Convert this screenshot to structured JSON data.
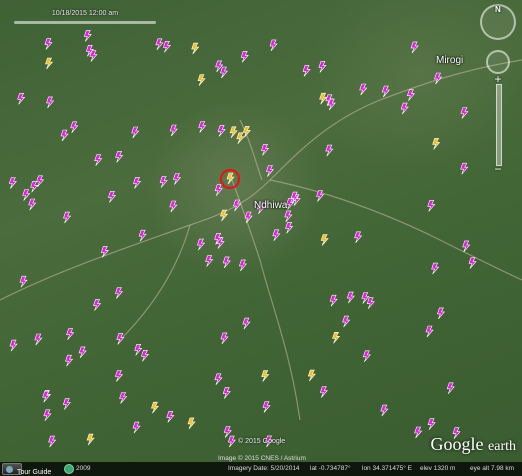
{
  "timeslider": {
    "label": "10/18/2015  12:00 am"
  },
  "places": [
    {
      "name": "Mirogi"
    },
    {
      "name": "Ndhiwa"
    }
  ],
  "copyright": "© 2015 Google",
  "logo": {
    "google": "Google",
    "earth": "earth"
  },
  "status": {
    "tour_guide": "Tour Guide",
    "year": "2009",
    "imagery_date": "Imagery Date: 5/20/2014",
    "lat": "lat    -0.734787°",
    "lon": "lon   34.371475° E",
    "elev": "elev  1320 m",
    "eye_alt": "eye alt   7.98 km"
  },
  "image_credit": "Image © 2015 CNES / Astrium",
  "nav": {
    "north": "N"
  },
  "colors": {
    "magenta_marker": "#e020e0",
    "yellow_marker": "#f0c020",
    "highlight_ring": "#e01818"
  },
  "markers": [
    {
      "c": "m"
    },
    {
      "c": "m"
    },
    {
      "c": "m"
    },
    {
      "c": "m"
    },
    {
      "c": "m"
    },
    {
      "c": "m"
    },
    {
      "c": "m"
    },
    {
      "c": "y"
    },
    {
      "c": "m"
    },
    {
      "c": "m"
    },
    {
      "c": "m"
    },
    {
      "c": "m"
    },
    {
      "c": "m"
    },
    {
      "c": "m"
    },
    {
      "c": "m"
    },
    {
      "c": "m"
    },
    {
      "c": "y"
    },
    {
      "c": "m"
    },
    {
      "c": "m"
    },
    {
      "c": "m"
    },
    {
      "c": "m"
    },
    {
      "c": "m"
    },
    {
      "c": "m"
    },
    {
      "c": "y"
    },
    {
      "c": "m"
    },
    {
      "c": "m"
    },
    {
      "c": "m"
    },
    {
      "c": "m"
    },
    {
      "c": "m"
    },
    {
      "c": "m"
    },
    {
      "c": "m"
    },
    {
      "c": "m"
    },
    {
      "c": "m"
    },
    {
      "c": "y"
    },
    {
      "c": "m"
    },
    {
      "c": "m"
    },
    {
      "c": "m"
    },
    {
      "c": "m"
    },
    {
      "c": "m"
    },
    {
      "c": "m"
    },
    {
      "c": "m"
    },
    {
      "c": "m"
    },
    {
      "c": "m"
    },
    {
      "c": "y"
    },
    {
      "c": "m"
    },
    {
      "c": "m"
    },
    {
      "c": "m"
    },
    {
      "c": "m"
    },
    {
      "c": "m"
    },
    {
      "c": "m"
    },
    {
      "c": "m"
    },
    {
      "c": "y"
    },
    {
      "c": "m"
    },
    {
      "c": "m"
    },
    {
      "c": "m"
    },
    {
      "c": "m"
    },
    {
      "c": "m"
    },
    {
      "c": "m"
    },
    {
      "c": "y"
    },
    {
      "c": "m"
    },
    {
      "c": "m"
    },
    {
      "c": "m"
    },
    {
      "c": "m"
    },
    {
      "c": "m"
    },
    {
      "c": "m"
    },
    {
      "c": "m"
    },
    {
      "c": "m"
    },
    {
      "c": "y"
    },
    {
      "c": "m"
    },
    {
      "c": "m"
    },
    {
      "c": "m"
    },
    {
      "c": "m"
    },
    {
      "c": "m"
    },
    {
      "c": "m"
    },
    {
      "c": "m"
    },
    {
      "c": "y"
    },
    {
      "c": "m"
    },
    {
      "c": "m"
    },
    {
      "c": "m"
    },
    {
      "c": "m"
    },
    {
      "c": "m"
    },
    {
      "c": "m"
    },
    {
      "c": "y"
    },
    {
      "c": "m"
    },
    {
      "c": "m"
    },
    {
      "c": "m"
    },
    {
      "c": "m"
    },
    {
      "c": "m"
    },
    {
      "c": "m"
    },
    {
      "c": "y"
    },
    {
      "c": "m"
    },
    {
      "c": "m"
    },
    {
      "c": "m"
    },
    {
      "c": "m"
    },
    {
      "c": "m"
    },
    {
      "c": "m"
    },
    {
      "c": "m"
    },
    {
      "c": "m"
    },
    {
      "c": "y"
    },
    {
      "c": "m"
    },
    {
      "c": "m"
    },
    {
      "c": "m"
    },
    {
      "c": "m"
    },
    {
      "c": "m"
    },
    {
      "c": "m"
    },
    {
      "c": "m"
    },
    {
      "c": "y"
    },
    {
      "c": "m"
    },
    {
      "c": "m"
    },
    {
      "c": "m"
    },
    {
      "c": "m"
    },
    {
      "c": "m"
    },
    {
      "c": "y"
    },
    {
      "c": "m"
    },
    {
      "c": "m"
    },
    {
      "c": "m"
    },
    {
      "c": "m"
    },
    {
      "c": "m"
    },
    {
      "c": "m"
    },
    {
      "c": "y"
    },
    {
      "c": "m"
    },
    {
      "c": "m"
    },
    {
      "c": "m"
    },
    {
      "c": "m"
    },
    {
      "c": "m"
    },
    {
      "c": "m"
    },
    {
      "c": "m"
    },
    {
      "c": "y"
    }
  ]
}
